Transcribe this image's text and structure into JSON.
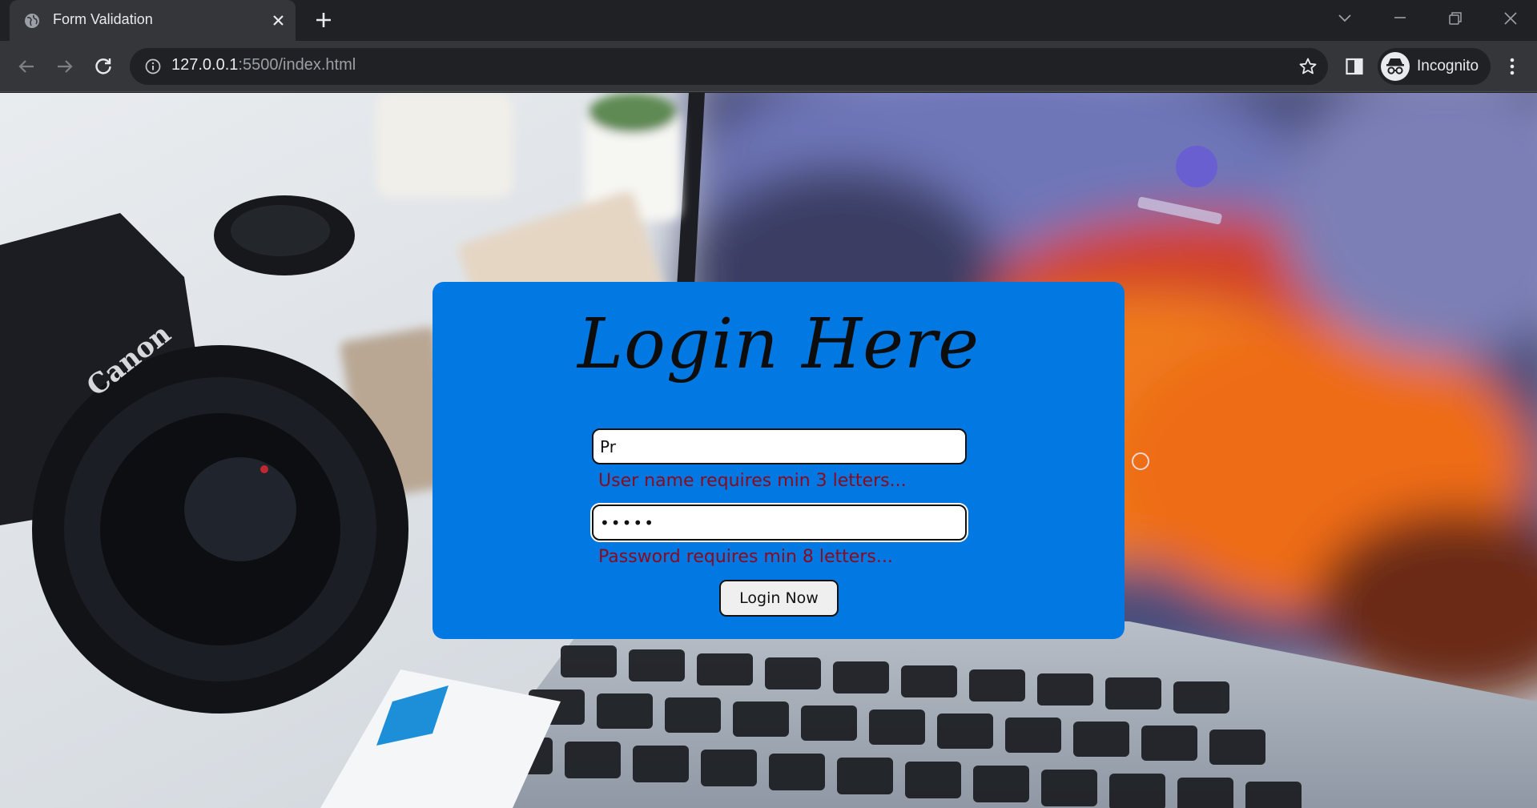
{
  "browser": {
    "tab_title": "Form Validation",
    "url_host": "127.0.0.1",
    "url_rest": ":5500/index.html",
    "profile_label": "Incognito",
    "icons": {
      "favicon": "globe-icon",
      "close": "close-icon",
      "new_tab": "plus-icon",
      "tab_search": "chevron-down-icon",
      "minimize": "minimize-icon",
      "restore": "restore-icon",
      "window_close": "close-icon",
      "back": "arrow-left-icon",
      "forward": "arrow-right-icon",
      "reload": "reload-icon",
      "site_info": "info-icon",
      "bookmark": "star-icon",
      "side_panel": "side-panel-icon",
      "incognito": "incognito-icon",
      "menu": "kebab-menu-icon"
    }
  },
  "page": {
    "heading": "Login Here",
    "username": {
      "value": "Pr",
      "error": "User name requires min 3 letters..."
    },
    "password": {
      "value": "•••••",
      "error": "Password requires min 8 letters..."
    },
    "submit_label": "Login Now",
    "colors": {
      "card": "#0178e2",
      "error": "#8b0a1c"
    }
  }
}
